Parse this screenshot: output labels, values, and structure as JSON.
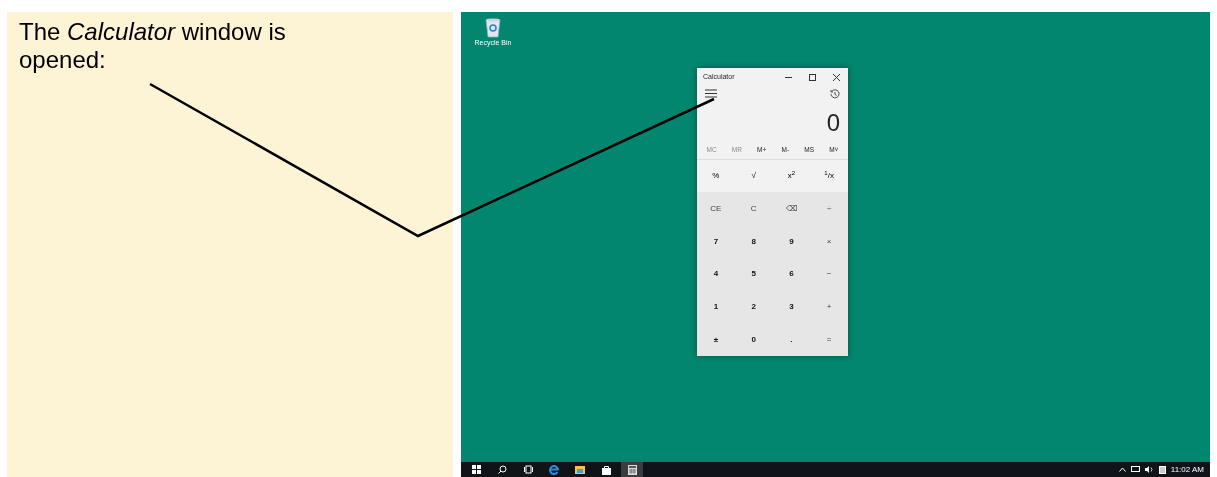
{
  "caption": "The *Calculator* window is opened:",
  "desktop": {
    "icons": [
      {
        "label": "Recycle Bin"
      }
    ]
  },
  "calculator": {
    "title": "Calculator",
    "display": "0",
    "memory": [
      {
        "label": "MC",
        "disabled": true
      },
      {
        "label": "MR",
        "disabled": true
      },
      {
        "label": "M+",
        "disabled": false
      },
      {
        "label": "M-",
        "disabled": false
      },
      {
        "label": "MS",
        "disabled": false
      },
      {
        "label": "M˅",
        "disabled": false
      }
    ],
    "keys": [
      {
        "label": "%",
        "kind": "function"
      },
      {
        "label": "√",
        "kind": "function"
      },
      {
        "label": "x$^{2}$",
        "kind": "function"
      },
      {
        "label": "$^{1}$/x",
        "kind": "function"
      },
      {
        "label": "CE",
        "kind": "operator"
      },
      {
        "label": "C",
        "kind": "operator"
      },
      {
        "label": "⌫",
        "kind": "operator"
      },
      {
        "label": "÷",
        "kind": "operator"
      },
      {
        "label": "7",
        "kind": "digit"
      },
      {
        "label": "8",
        "kind": "digit"
      },
      {
        "label": "9",
        "kind": "digit"
      },
      {
        "label": "×",
        "kind": "operator"
      },
      {
        "label": "4",
        "kind": "digit"
      },
      {
        "label": "5",
        "kind": "digit"
      },
      {
        "label": "6",
        "kind": "digit"
      },
      {
        "label": "−",
        "kind": "operator"
      },
      {
        "label": "1",
        "kind": "digit"
      },
      {
        "label": "2",
        "kind": "digit"
      },
      {
        "label": "3",
        "kind": "digit"
      },
      {
        "label": "+",
        "kind": "operator"
      },
      {
        "label": "±",
        "kind": "digit"
      },
      {
        "label": "0",
        "kind": "digit"
      },
      {
        "label": ".",
        "kind": "digit"
      },
      {
        "label": "=",
        "kind": "operator"
      }
    ]
  },
  "taskbar": {
    "apps": [
      {
        "kind": "start",
        "selected": false
      },
      {
        "kind": "search",
        "selected": false
      },
      {
        "kind": "taskview",
        "selected": false
      },
      {
        "kind": "browser",
        "selected": false
      },
      {
        "kind": "folder",
        "selected": false
      },
      {
        "kind": "store",
        "selected": false
      },
      {
        "kind": "calculator",
        "selected": true
      }
    ],
    "clock": "11:02 AM"
  }
}
